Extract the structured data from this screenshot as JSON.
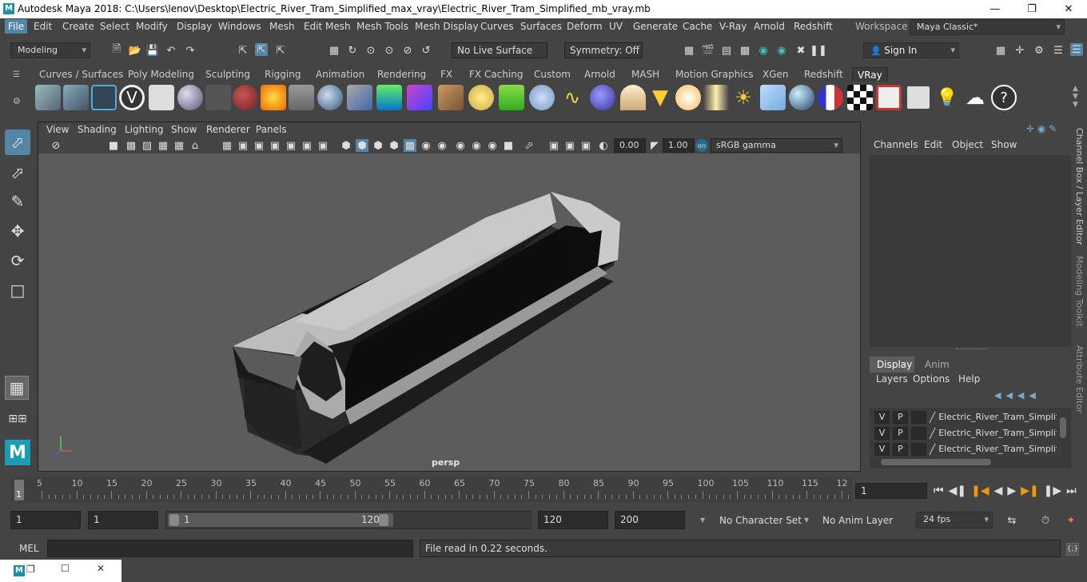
{
  "window": {
    "title": "Autodesk Maya 2018: C:\\Users\\lenov\\Desktop\\Electric_River_Tram_Simplified_max_vray\\Electric_River_Tram_Simplified_mb_vray.mb",
    "minimize_icon": "minimize-icon",
    "maximize_icon": "restore-icon",
    "close_icon": "close-icon"
  },
  "menu": [
    "File",
    "Edit",
    "Create",
    "Select",
    "Modify",
    "Display",
    "Windows",
    "Mesh",
    "Edit Mesh",
    "Mesh Tools",
    "Mesh Display",
    "Curves",
    "Surfaces",
    "Deform",
    "UV",
    "Generate",
    "Cache",
    "V-Ray",
    "Arnold",
    "Redshift"
  ],
  "workspace": {
    "label": "Workspace :",
    "value": "Maya Classic*"
  },
  "status": {
    "mode": "Modeling",
    "live_surface": "No Live Surface",
    "symmetry": "Symmetry: Off",
    "sign_in": "Sign In"
  },
  "shelf_tabs": [
    "Curves / Surfaces",
    "Poly Modeling",
    "Sculpting",
    "Rigging",
    "Animation",
    "Rendering",
    "FX",
    "FX Caching",
    "Custom",
    "Arnold",
    "MASH",
    "Motion Graphics",
    "XGen",
    "Redshift",
    "VRay"
  ],
  "shelf_selected": "VRay",
  "viewport": {
    "menu": [
      "View",
      "Shading",
      "Lighting",
      "Show",
      "Renderer",
      "Panels"
    ],
    "exposure": "0.00",
    "gamma": "1.00",
    "color_space": "sRGB gamma",
    "camera_label": "persp"
  },
  "channel_box": {
    "menu": [
      "Channels",
      "Edit",
      "Object",
      "Show"
    ]
  },
  "layer_editor": {
    "tabs": [
      "Display",
      "Anim"
    ],
    "menu": [
      "Layers",
      "Options",
      "Help"
    ],
    "layers": [
      {
        "v": "V",
        "p": "P",
        "name": "Electric_River_Tram_Simplified"
      },
      {
        "v": "V",
        "p": "P",
        "name": "Electric_River_Tram_Simplified"
      },
      {
        "v": "V",
        "p": "P",
        "name": "Electric_River_Tram_Simplified"
      }
    ]
  },
  "side_tabs": [
    "Channel Box / Layer Editor",
    "Modeling Toolkit",
    "Attribute Editor"
  ],
  "timeline": {
    "ticks": [
      "5",
      "10",
      "15",
      "20",
      "25",
      "30",
      "35",
      "40",
      "45",
      "50",
      "55",
      "60",
      "65",
      "70",
      "75",
      "80",
      "85",
      "90",
      "95",
      "100",
      "105",
      "110",
      "115",
      "12"
    ],
    "start_marker": "1",
    "current_frame": "1"
  },
  "range": {
    "start": "1",
    "playback_start": "1",
    "slider_start": "1",
    "slider_end": "120",
    "playback_end": "120",
    "end": "200",
    "character_set": "No Character Set",
    "anim_layer": "No Anim Layer",
    "fps": "24 fps"
  },
  "command": {
    "lang": "MEL",
    "feedback": "File read in  0.22 seconds."
  }
}
